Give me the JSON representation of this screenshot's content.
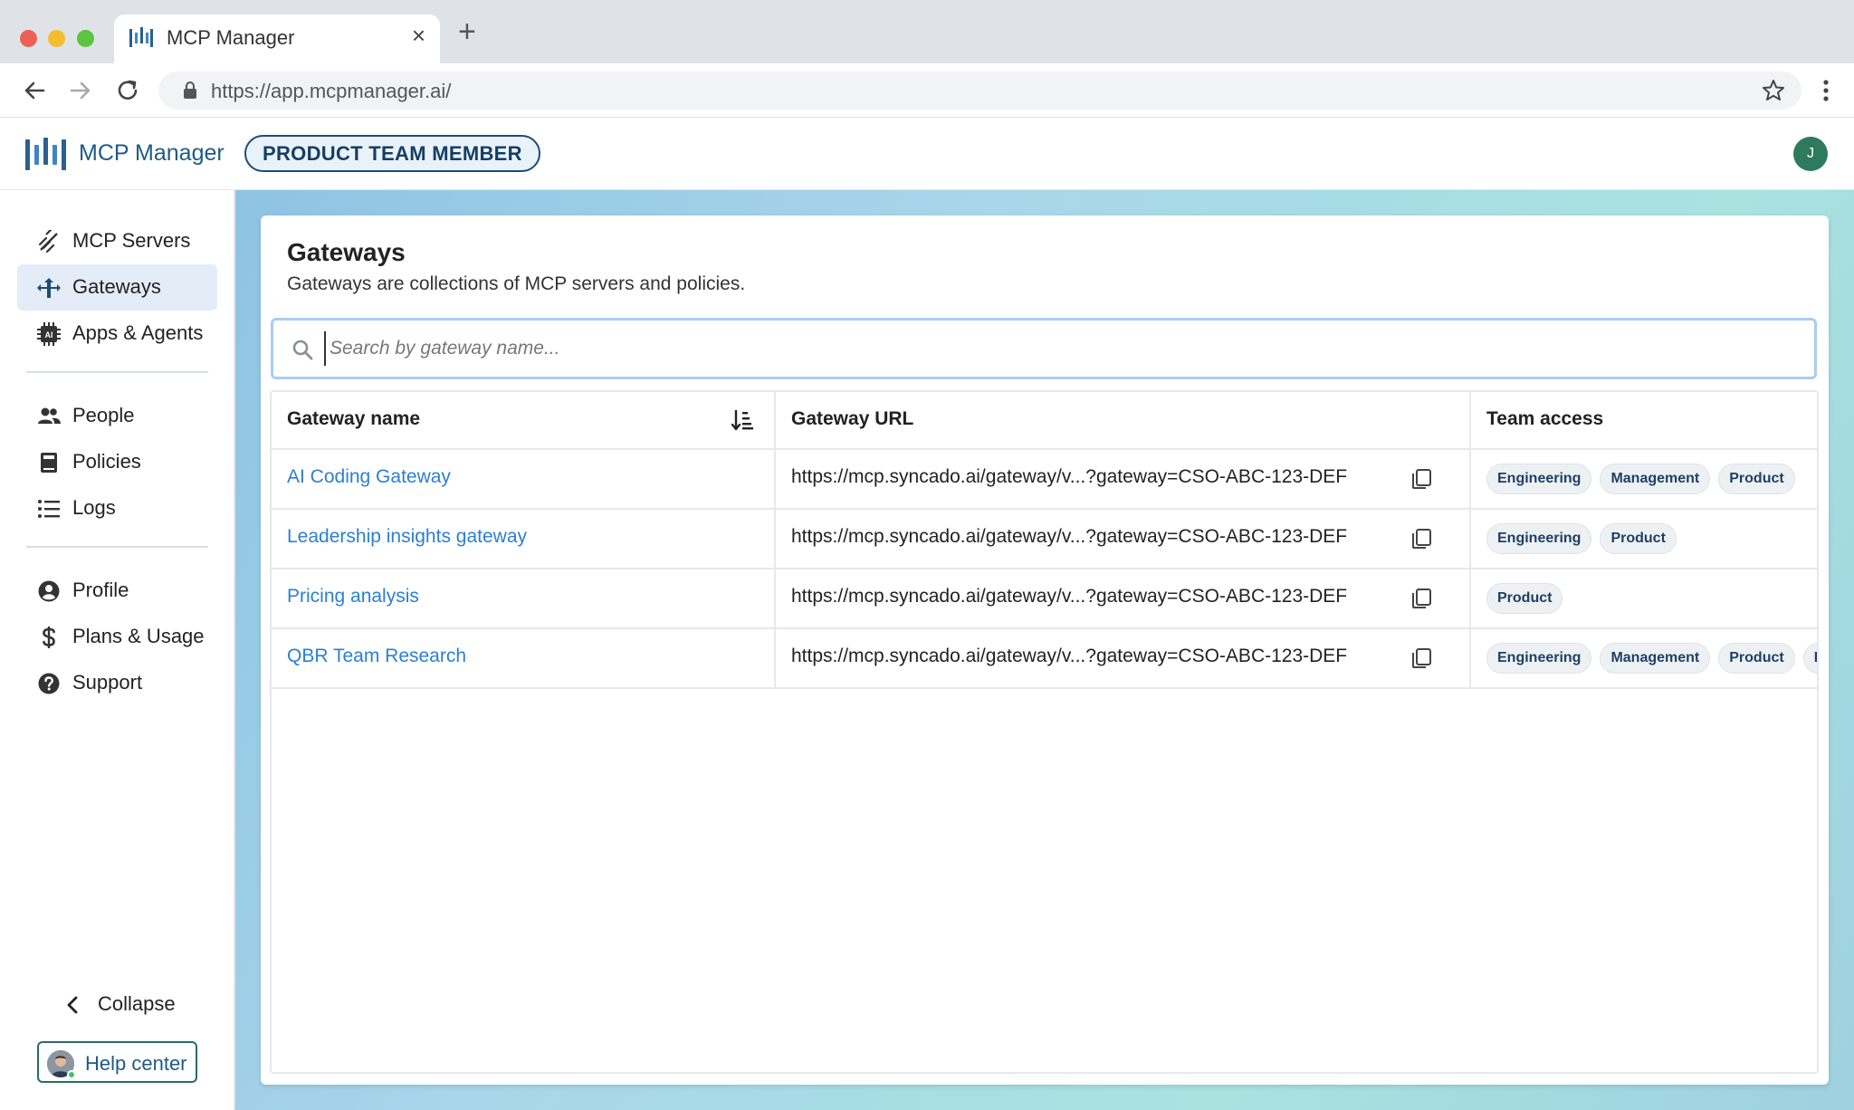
{
  "browser": {
    "tab_title": "MCP Manager",
    "url": "https://app.mcpmanager.ai/"
  },
  "header": {
    "app_name": "MCP Manager",
    "role_badge": "PRODUCT TEAM MEMBER",
    "avatar_initial": "J"
  },
  "sidebar": {
    "items": [
      {
        "label": "MCP Servers",
        "icon": "plug-icon"
      },
      {
        "label": "Gateways",
        "icon": "gateway-icon",
        "active": true
      },
      {
        "label": "Apps & Agents",
        "icon": "ai-chip-icon"
      },
      {
        "label": "People",
        "icon": "people-icon"
      },
      {
        "label": "Policies",
        "icon": "book-icon"
      },
      {
        "label": "Logs",
        "icon": "list-icon"
      },
      {
        "label": "Profile",
        "icon": "user-circle-icon"
      },
      {
        "label": "Plans & Usage",
        "icon": "dollar-icon"
      },
      {
        "label": "Support",
        "icon": "question-icon"
      }
    ],
    "collapse_label": "Collapse",
    "help_label": "Help center"
  },
  "main": {
    "title": "Gateways",
    "subtitle": "Gateways are collections of MCP servers and policies.",
    "search_placeholder": "Search by gateway name...",
    "columns": [
      "Gateway name",
      "Gateway URL",
      "Team access"
    ],
    "rows": [
      {
        "name": "AI Coding Gateway",
        "url": "https://mcp.syncado.ai/gateway/v...?gateway=CSO-ABC-123-DEF",
        "teams": [
          "Engineering",
          "Management",
          "Product"
        ]
      },
      {
        "name": "Leadership insights gateway",
        "url": "https://mcp.syncado.ai/gateway/v...?gateway=CSO-ABC-123-DEF",
        "teams": [
          "Engineering",
          "Product"
        ]
      },
      {
        "name": "Pricing analysis",
        "url": "https://mcp.syncado.ai/gateway/v...?gateway=CSO-ABC-123-DEF",
        "teams": [
          "Product"
        ]
      },
      {
        "name": "QBR Team Research",
        "url": "https://mcp.syncado.ai/gateway/v...?gateway=CSO-ABC-123-DEF",
        "teams": [
          "Engineering",
          "Management",
          "Product",
          "Design"
        ]
      }
    ]
  },
  "colors": {
    "brand": "#1f5a86",
    "link": "#2b7fd4",
    "active_nav": "#e4edf7"
  }
}
